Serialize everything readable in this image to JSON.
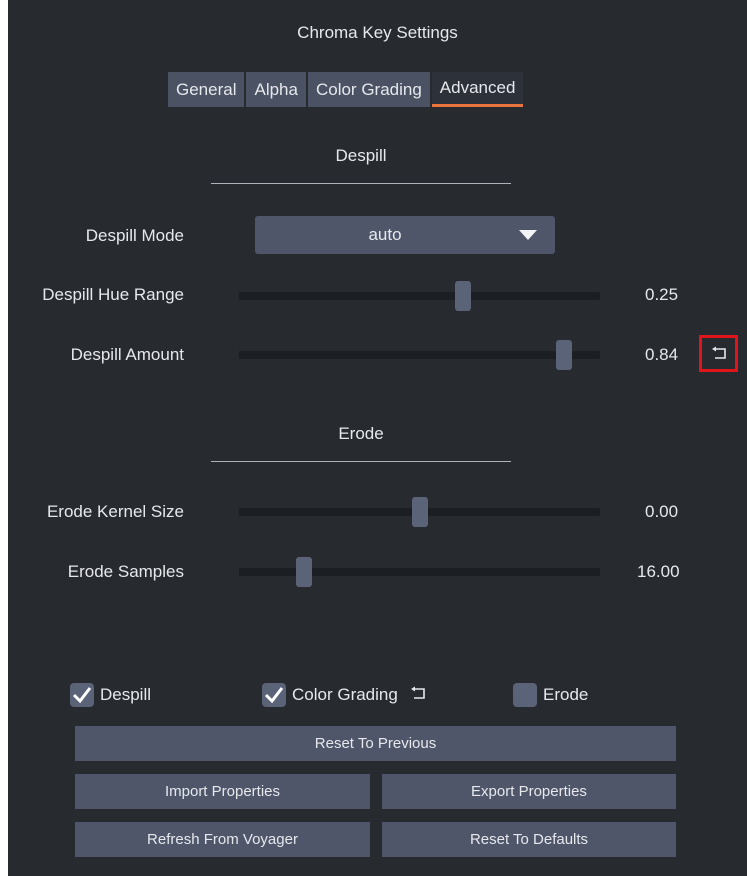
{
  "window": {
    "title": "Chroma Key Settings"
  },
  "tabs": [
    {
      "label": "General",
      "active": false
    },
    {
      "label": "Alpha",
      "active": false
    },
    {
      "label": "Color Grading",
      "active": false
    },
    {
      "label": "Advanced",
      "active": true
    }
  ],
  "despill": {
    "section_title": "Despill",
    "mode": {
      "label": "Despill Mode",
      "value": "auto"
    },
    "hue_range": {
      "label": "Despill Hue Range",
      "value": "0.25",
      "slider_fraction": 0.62
    },
    "amount": {
      "label": "Despill Amount",
      "value": "0.84",
      "slider_fraction": 0.9,
      "reset_icon": "reset-arrow-icon",
      "highlighted": true
    }
  },
  "erode": {
    "section_title": "Erode",
    "kernel_size": {
      "label": "Erode Kernel Size",
      "value": "0.00",
      "slider_fraction": 0.5
    },
    "samples": {
      "label": "Erode Samples",
      "value": "16.00",
      "slider_fraction": 0.18
    }
  },
  "toggles": [
    {
      "label": "Despill",
      "checked": true
    },
    {
      "label": "Color Grading",
      "checked": true,
      "reset_icon": "reset-arrow-icon"
    },
    {
      "label": "Erode",
      "checked": false
    }
  ],
  "buttons": {
    "reset_previous": "Reset To Previous",
    "import": "Import Properties",
    "export": "Export Properties",
    "refresh": "Refresh From Voyager",
    "reset_defaults": "Reset To Defaults"
  },
  "colors": {
    "background": "#272b30",
    "control": "#4f566a",
    "accent_underline": "#e8743b",
    "highlight_box": "#e0141b"
  }
}
